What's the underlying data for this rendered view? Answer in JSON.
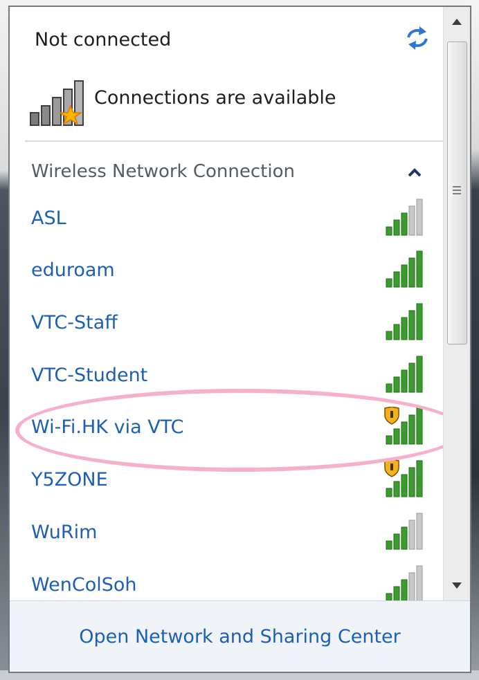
{
  "status": {
    "title": "Not connected",
    "subtitle": "Connections are available",
    "refresh_icon": "refresh-arrows-icon",
    "connection_icon": "signal-bars-star-icon"
  },
  "section": {
    "title": "Wireless Network Connection",
    "collapse_icon": "chevron-up-icon"
  },
  "networks": [
    {
      "name": "ASL",
      "signal": 2,
      "secured_warning": false
    },
    {
      "name": "eduroam",
      "signal": 4,
      "secured_warning": false
    },
    {
      "name": "VTC-Staff",
      "signal": 4,
      "secured_warning": false
    },
    {
      "name": "VTC-Student",
      "signal": 4,
      "secured_warning": false
    },
    {
      "name": "Wi-Fi.HK via VTC",
      "signal": 4,
      "secured_warning": true
    },
    {
      "name": "Y5ZONE",
      "signal": 4,
      "secured_warning": true
    },
    {
      "name": "WuRim",
      "signal": 2,
      "secured_warning": false
    },
    {
      "name": "WenColSoh",
      "signal": 2,
      "secured_warning": false
    }
  ],
  "footer": {
    "link": "Open Network and Sharing Center"
  },
  "colors": {
    "link": "#1c5fb5",
    "signal_on": "#3a9d2e",
    "signal_off": "#c8c8c8",
    "highlight": "#f7b0cc"
  }
}
